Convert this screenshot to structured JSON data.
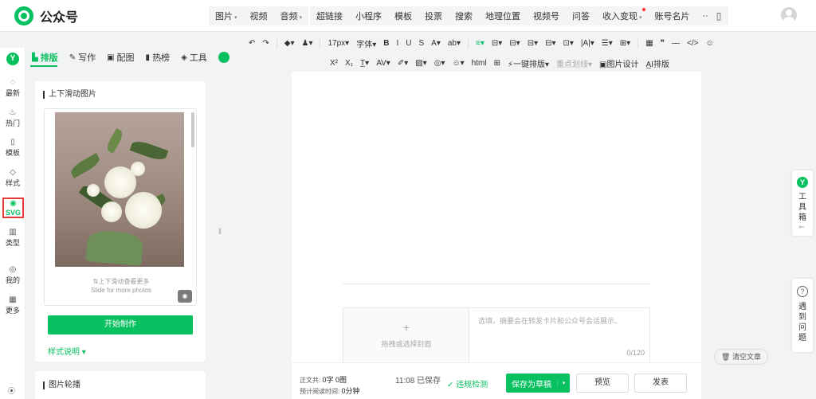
{
  "brand": {
    "name": "公众号",
    "accent": "#07c160"
  },
  "topnav": {
    "group1": [
      {
        "label": "图片",
        "caret": true
      },
      {
        "label": "视频",
        "caret": false
      },
      {
        "label": "音频",
        "caret": true
      }
    ],
    "group2": [
      {
        "label": "超链接",
        "caret": false,
        "dot": false
      },
      {
        "label": "小程序",
        "caret": false,
        "dot": false
      },
      {
        "label": "模板",
        "caret": false,
        "dot": false
      },
      {
        "label": "投票",
        "caret": false,
        "dot": false
      },
      {
        "label": "搜索",
        "caret": false,
        "dot": false
      },
      {
        "label": "地理位置",
        "caret": false,
        "dot": false
      },
      {
        "label": "视频号",
        "caret": false,
        "dot": false
      },
      {
        "label": "问答",
        "caret": false,
        "dot": false
      },
      {
        "label": "收入变现",
        "caret": true,
        "dot": true
      },
      {
        "label": "账号名片",
        "caret": false,
        "dot": false
      },
      {
        "label": "···",
        "caret": false,
        "dot": false
      }
    ]
  },
  "rail": {
    "logo": "Y",
    "items": [
      {
        "label": "最新",
        "icon": "chat-icon",
        "glyph": "◌"
      },
      {
        "label": "热门",
        "icon": "fire-icon",
        "glyph": "♨"
      },
      {
        "label": "模板",
        "icon": "template-icon",
        "glyph": "▯"
      },
      {
        "label": "样式",
        "icon": "style-icon",
        "glyph": "◇"
      },
      {
        "label": "SVG",
        "icon": "svg-icon",
        "glyph": "◉",
        "active": true
      },
      {
        "label": "类型",
        "icon": "type-icon",
        "glyph": "▥"
      },
      {
        "label": "我的",
        "icon": "user-icon",
        "glyph": "◎"
      },
      {
        "label": "更多",
        "icon": "grid-icon",
        "glyph": "▦"
      }
    ],
    "help_glyph": "⦿"
  },
  "tabs": [
    {
      "label": "排版",
      "icon": "layout-icon",
      "glyph": "▙",
      "active": true
    },
    {
      "label": "写作",
      "icon": "pen-icon",
      "glyph": "✎"
    },
    {
      "label": "配图",
      "icon": "image-icon",
      "glyph": "▣"
    },
    {
      "label": "热榜",
      "icon": "bookmark-icon",
      "glyph": "▮"
    },
    {
      "label": "工具",
      "icon": "cube-icon",
      "glyph": "◈"
    }
  ],
  "toolbar": {
    "row1": [
      "↶",
      "↷",
      "|",
      "◆▾",
      "♟▾",
      "|",
      "17px▾",
      "字体▾",
      "B",
      "I",
      "U",
      "S",
      "A▾",
      "ab▾",
      "|",
      "≡▾",
      "⊟▾",
      "⊟▾",
      "⊟▾",
      "⊟▾",
      "⊡▾",
      "|A|▾",
      "☰▾",
      "⊞▾",
      "|",
      "▦",
      "❞",
      "—",
      "</>",
      "☺"
    ],
    "row2": [
      "X²",
      "X₁",
      "T̲▾",
      "AV▾",
      "✐▾",
      "▨▾",
      "◎▾",
      "☺▾",
      "html",
      "⊞",
      "⚡一键排版▾",
      "重点划线▾",
      "▣图片设计",
      "A̲I排版"
    ]
  },
  "panel": {
    "title": "上下滑动图片",
    "hint_cn": "⇅上下滑动查看更多",
    "hint_en": "Slide for more photos",
    "start_button": "开始制作",
    "style_link": "样式说明 ▾",
    "eye_glyph": "◉"
  },
  "panel2": {
    "title": "图片轮播"
  },
  "editor": {
    "cover_plus": "+",
    "cover_text": "拖拽或选择封面",
    "summary_placeholder": "选填，摘要会在转发卡片和公众号会话展示。",
    "summary_count": "0/120"
  },
  "right": {
    "toolbox_logo": "Y",
    "toolbox_chars": [
      "工",
      "具",
      "箱"
    ],
    "toolbox_arrow": "⇐",
    "help_q": "?",
    "help_chars": [
      "遇",
      "到",
      "问",
      "题"
    ],
    "clear_label": "🗑 清空文章"
  },
  "bottom": {
    "wordcount_label": "正文共:",
    "wordcount_value": "0字 0图",
    "readtime_label": "预计阅读时间:",
    "readtime_value": "0分钟",
    "saved": "11:08  已保存",
    "check": "✓ 违规检测",
    "draft": "保存为草稿",
    "draft_caret": "▾",
    "preview": "预览",
    "publish": "发表"
  },
  "mobile_glyph": "▯"
}
